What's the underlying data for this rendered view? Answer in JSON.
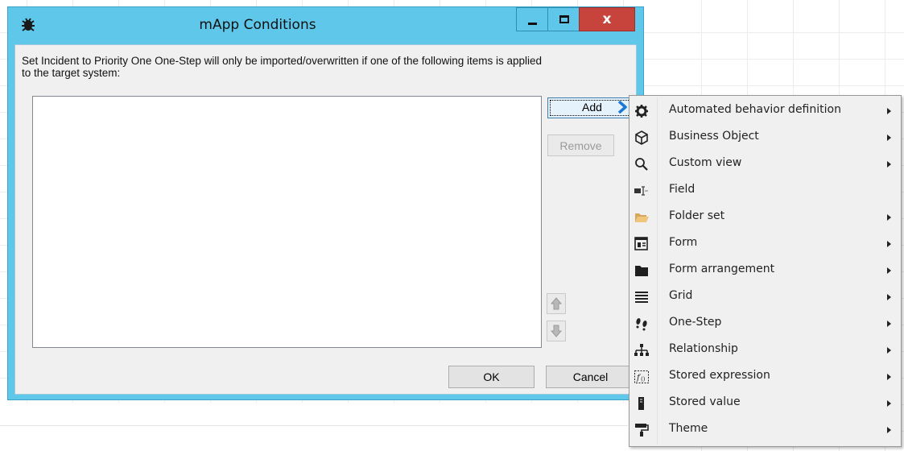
{
  "window": {
    "title": "mApp Conditions",
    "close_label": "x"
  },
  "dialog": {
    "description": "Set Incident to Priority One One-Step will only be imported/overwritten if one of the following items is applied to the target system:",
    "add_label": "Add",
    "remove_label": "Remove",
    "ok_label": "OK",
    "cancel_label": "Cancel"
  },
  "menu": {
    "items": [
      {
        "label": "Automated behavior definition",
        "icon": "gear-icon",
        "submenu": true
      },
      {
        "label": "Business Object",
        "icon": "cube-icon",
        "submenu": true
      },
      {
        "label": "Custom view",
        "icon": "magnifier-icon",
        "submenu": true
      },
      {
        "label": "Field",
        "icon": "field-icon",
        "submenu": false
      },
      {
        "label": "Folder set",
        "icon": "folder-open-icon",
        "submenu": true
      },
      {
        "label": "Form",
        "icon": "form-icon",
        "submenu": true
      },
      {
        "label": "Form arrangement",
        "icon": "folder-icon",
        "submenu": true
      },
      {
        "label": "Grid",
        "icon": "grid-icon",
        "submenu": true
      },
      {
        "label": "One-Step",
        "icon": "footsteps-icon",
        "submenu": true
      },
      {
        "label": "Relationship",
        "icon": "hierarchy-icon",
        "submenu": true
      },
      {
        "label": "Stored expression",
        "icon": "function-icon",
        "submenu": true
      },
      {
        "label": "Stored value",
        "icon": "storage-icon",
        "submenu": true
      },
      {
        "label": "Theme",
        "icon": "paint-roller-icon",
        "submenu": true
      }
    ]
  },
  "colors": {
    "titlebar": "#5ec7ea",
    "close_button": "#c7443c",
    "add_arrow": "#1e78d2"
  }
}
